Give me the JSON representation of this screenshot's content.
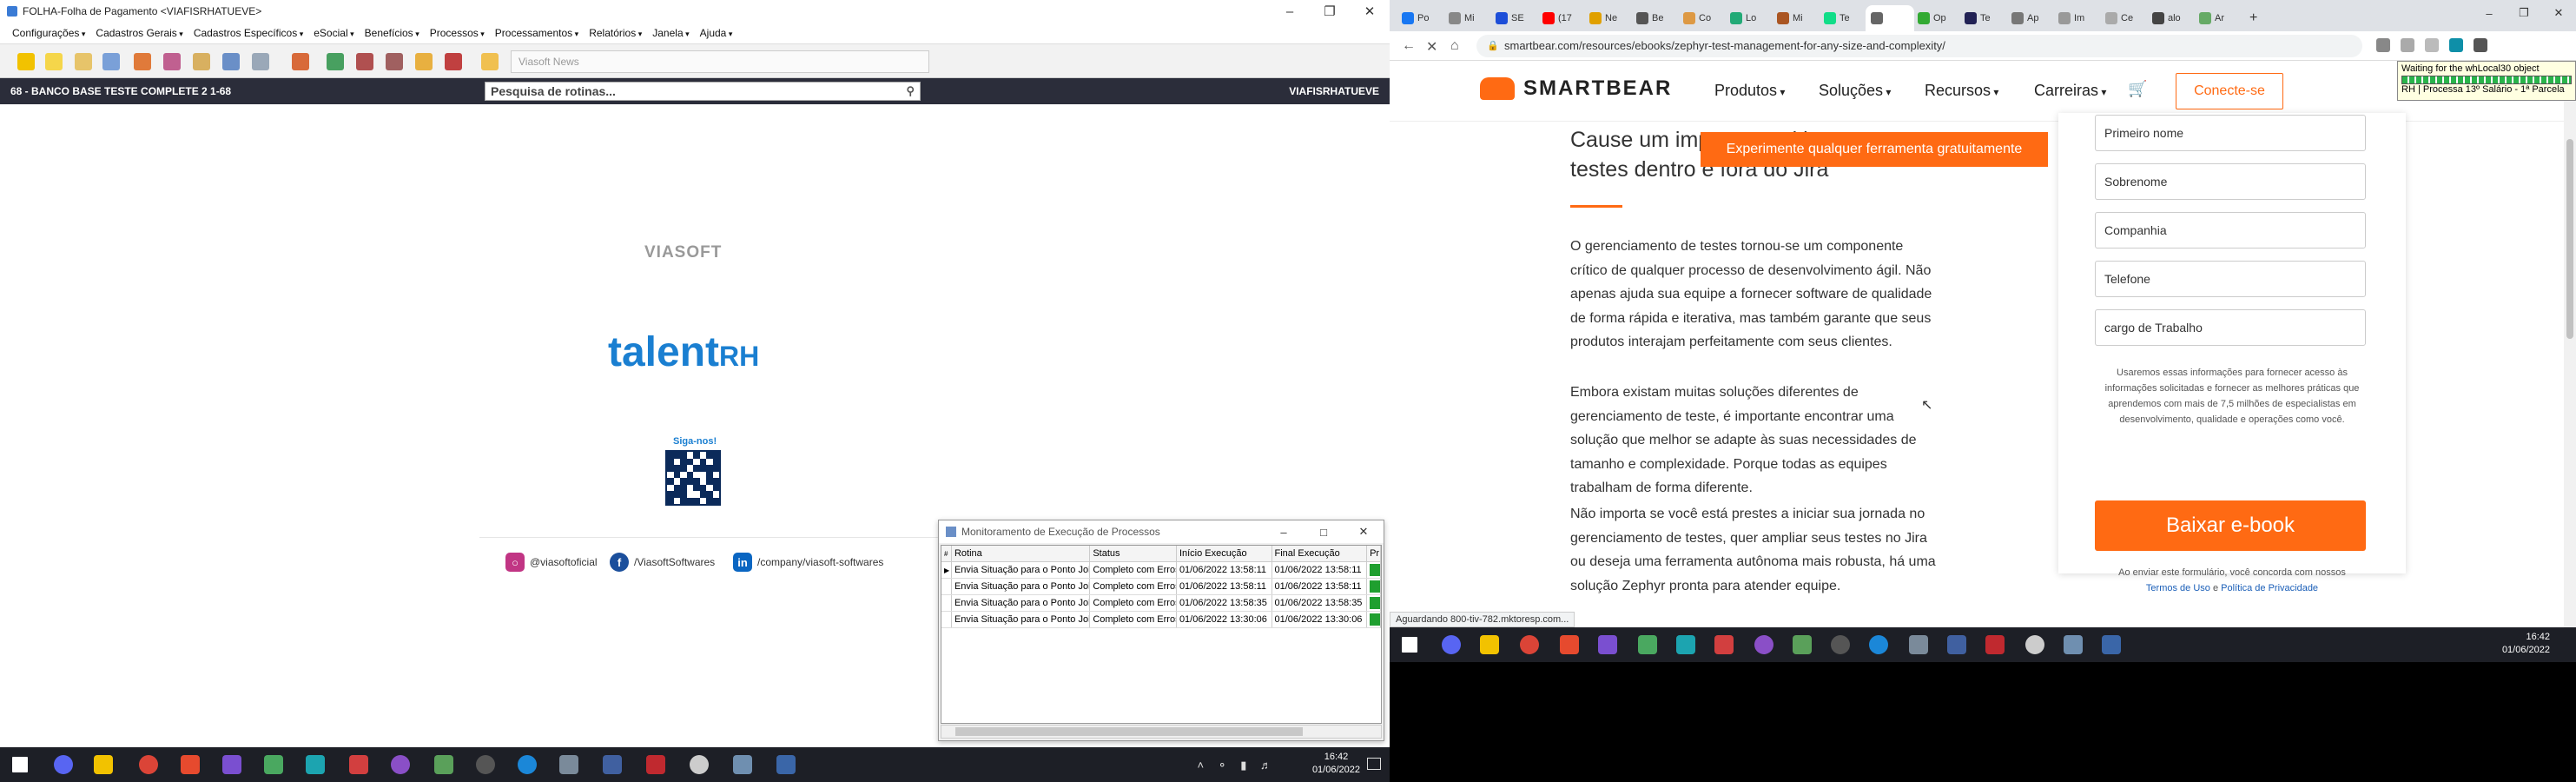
{
  "left_app": {
    "title": "FOLHA-Folha de Pagamento <VIAFISRHATUEVE>",
    "menu": [
      "Configurações",
      "Cadastros Gerais",
      "Cadastros Específicos",
      "eSocial",
      "Benefícios",
      "Processos",
      "Processamentos",
      "Relatórios",
      "Janela",
      "Ajuda"
    ],
    "news_label": "Viasoft News",
    "status_left": "68 - BANCO BASE TESTE COMPLETE 2 1-68",
    "status_right": "VIAFISRHATUEVE",
    "routine_search_placeholder": "Pesquisa de rotinas...",
    "viasoft_logo": "VIASOFT",
    "talent_logo_main": "talent",
    "talent_logo_suffix": "RH",
    "follow_label": "Siga-nos!",
    "social": [
      {
        "icon": "instagram-icon",
        "label": "@viasoftoficial",
        "color": "#c13584"
      },
      {
        "icon": "facebook-icon",
        "label": "/ViasoftSoftwares",
        "color": "#1b4f9c"
      },
      {
        "icon": "linkedin-icon",
        "label": "/company/viasoft-softwares",
        "color": "#0a66c2"
      }
    ]
  },
  "process_window": {
    "title": "Monitoramento de Execução de Processos",
    "columns": [
      "Rotina",
      "Status",
      "Início Execução",
      "Final Execução",
      "Pr"
    ],
    "rows": [
      {
        "rotina": "Envia Situação para o Ponto Job",
        "status": "Completo com Erros",
        "inicio": "01/06/2022 13:58:11",
        "final": "01/06/2022 13:58:11"
      },
      {
        "rotina": "Envia Situação para o Ponto Job",
        "status": "Completo com Erros",
        "inicio": "01/06/2022 13:58:11",
        "final": "01/06/2022 13:58:11"
      },
      {
        "rotina": "Envia Situação para o Ponto Job",
        "status": "Completo com Erros",
        "inicio": "01/06/2022 13:58:35",
        "final": "01/06/2022 13:58:35"
      },
      {
        "rotina": "Envia Situação para o Ponto Job",
        "status": "Completo com Erros",
        "inicio": "01/06/2022 13:30:06",
        "final": "01/06/2022 13:30:06"
      }
    ]
  },
  "left_taskbar": {
    "time": "16:42",
    "date": "01/06/2022"
  },
  "browser": {
    "tabs": [
      "Po",
      "Mi",
      "SE",
      "(17",
      "Ne",
      "Be",
      "Co",
      "Lo",
      "Mi",
      "Te",
      "",
      "Op",
      "Te",
      "Ap",
      "Im",
      "Ce",
      "alo",
      "Ar"
    ],
    "url": "smartbear.com/resources/ebooks/zephyr-test-management-for-any-size-and-complexity/",
    "tooltip_line1": "Waiting for the whLocal30 object",
    "tooltip_line2": "RH | Processa 13º Salário - 1ª Parcela",
    "hover_status": "Aguardando 800-tiv-782.mktoresp.com..."
  },
  "smartbear": {
    "logo": "SMARTBEAR",
    "nav": [
      "Produtos",
      "Soluções",
      "Recursos"
    ],
    "careers": "Carreiras",
    "cta": "Conecte-se",
    "hero": "Cause um impacto positivo nos testes dentro e fora do Jira",
    "try_button": "Experimente qualquer ferramenta gratuitamente",
    "paragraphs": [
      "O gerenciamento de testes tornou-se um componente crítico de qualquer processo de desenvolvimento ágil. Não apenas ajuda sua equipe a fornecer software de qualidade de forma rápida e iterativa, mas também garante que seus produtos interajam perfeitamente com seus clientes.",
      "Embora existam muitas soluções diferentes de gerenciamento de teste, é importante encontrar uma solução que melhor se adapte às suas necessidades de tamanho e complexidade. Porque todas as equipes trabalham de forma diferente.",
      "Não importa se você está prestes a iniciar sua jornada no gerenciamento de testes, quer ampliar seus testes no Jira ou deseja uma ferramenta autônoma mais robusta, há uma solução Zephyr pronta para atender equipe."
    ],
    "form_fields": [
      "Primeiro nome",
      "Sobrenome",
      "Companhia",
      "Telefone",
      "cargo de Trabalho"
    ],
    "consent": "Usaremos essas informações para fornecer acesso às informações solicitadas e fornecer as melhores práticas que aprendemos com mais de 7,5 milhões de especialistas em desenvolvimento, qualidade e operações como você.",
    "download": "Baixar e-book",
    "terms_prefix": "Ao enviar este formulário, você concorda com nossos",
    "terms_link": "Termos de Uso",
    "terms_and": "e",
    "privacy_link": "Política de Privacidade"
  },
  "right_taskbar": {
    "time": "16:42",
    "date": "01/06/2022"
  },
  "colors": {
    "smartbear_orange": "#ff6a13",
    "viasoft_blue": "#1a7fd1",
    "status_dark": "#2b2d3a",
    "ok_green": "#1f9f2f"
  }
}
